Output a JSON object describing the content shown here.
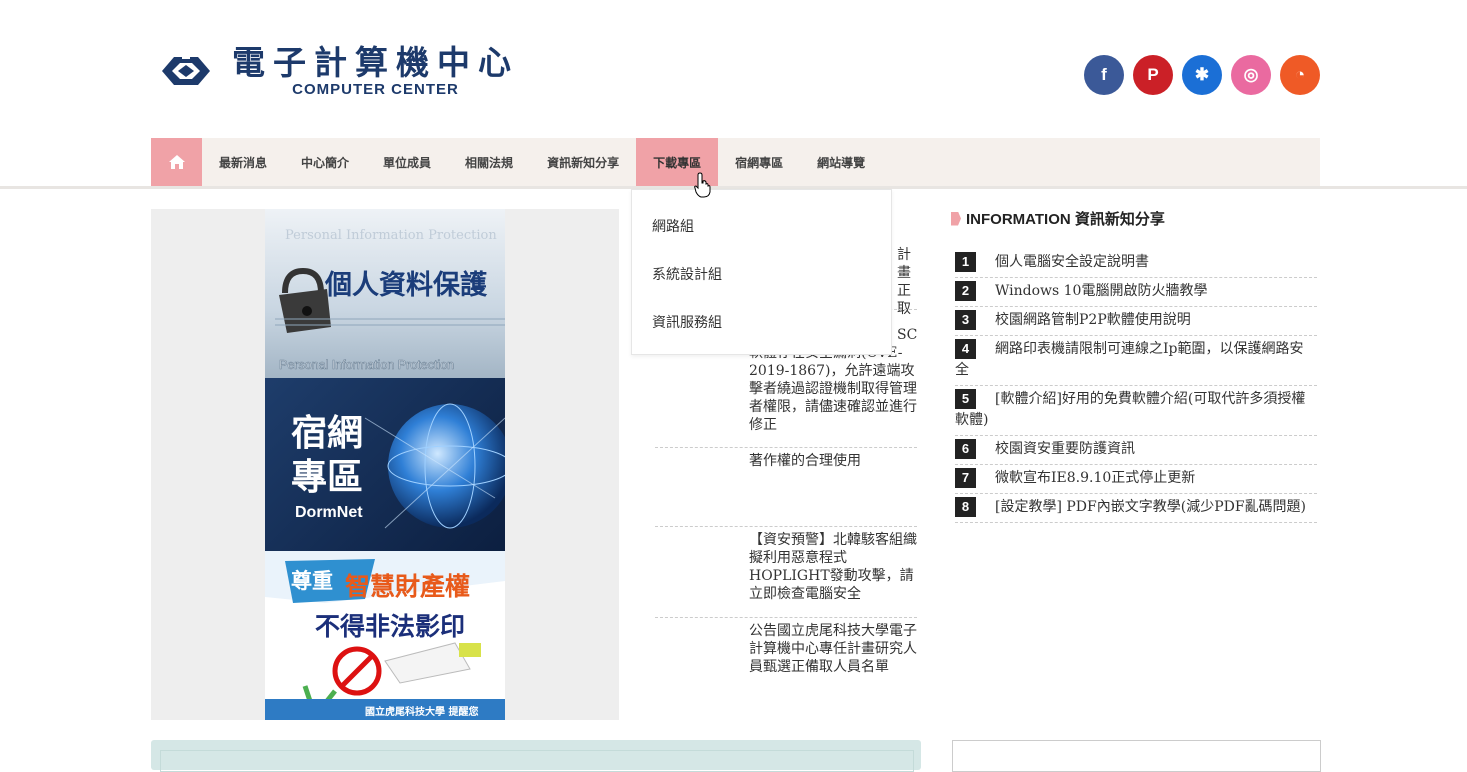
{
  "header": {
    "logo_zh": "電子計算機中心",
    "logo_en": "COMPUTER CENTER",
    "social": [
      {
        "icon": "facebook-icon",
        "glyph": "f",
        "color": "#3b5998"
      },
      {
        "icon": "pinterest-icon",
        "glyph": "P",
        "color": "#cb2027"
      },
      {
        "icon": "myspace-icon",
        "glyph": "✱",
        "color": "#1b6fd6"
      },
      {
        "icon": "dribbble-icon",
        "glyph": "◎",
        "color": "#ea6aa0"
      },
      {
        "icon": "rss-icon",
        "glyph": "◔",
        "color": "#ef5a26"
      }
    ]
  },
  "nav": {
    "home_icon": "home-icon",
    "items": [
      "最新消息",
      "中心簡介",
      "單位成員",
      "相關法規",
      "資訊新知分享",
      "下載專區",
      "宿網專區",
      "網站導覽"
    ],
    "active_index": 5,
    "dropdown": [
      "網路組",
      "系統設計組",
      "資訊服務組"
    ]
  },
  "banners": {
    "b1_zh": "個人資料保護",
    "b1_en": "Personal Information Protection",
    "b2_zh1": "宿網",
    "b2_zh2": "專區",
    "b2_en": "DormNet",
    "b3_line1a": "尊重",
    "b3_line1b": "智慧財產權",
    "b3_line2": "不得非法影印",
    "b3_footer": "國立虎尾科技大學 提醒您"
  },
  "news": {
    "partial1": "計畫\n正取",
    "partial2": "軟體存在安全漏洞(CVE-2019-1867)，允許遠端攻擊者繞過認證機制取得管理者權限，請儘速確認並進行修正",
    "partial2_top": "SC",
    "item3": "著作權的合理使用",
    "item4": "【資安預警】北韓駭客組織擬利用惡意程式HOPLIGHT發動攻擊，請立即檢查電腦安全",
    "item5": "公告國立虎尾科技大學電子計算機中心專任計畫研究人員甄選正備取人員名單"
  },
  "info": {
    "title": "INFORMATION 資訊新知分享",
    "items": [
      {
        "num": "1",
        "text": "個人電腦安全設定說明書"
      },
      {
        "num": "2",
        "text": "Windows 10電腦開啟防火牆教學"
      },
      {
        "num": "3",
        "text": "校園網路管制P2P軟體使用說明"
      },
      {
        "num": "4",
        "text": "網路印表機請限制可連線之Ip範圍，以保護網路安全"
      },
      {
        "num": "5",
        "text": "[軟體介紹]好用的免費軟體介紹(可取代許多須授權軟體)"
      },
      {
        "num": "6",
        "text": "校園資安重要防護資訊"
      },
      {
        "num": "7",
        "text": "微軟宣布IE8.9.10正式停止更新"
      },
      {
        "num": "8",
        "text": "[設定教學] PDF內嵌文字教學(減少PDF亂碼問題)"
      }
    ]
  }
}
